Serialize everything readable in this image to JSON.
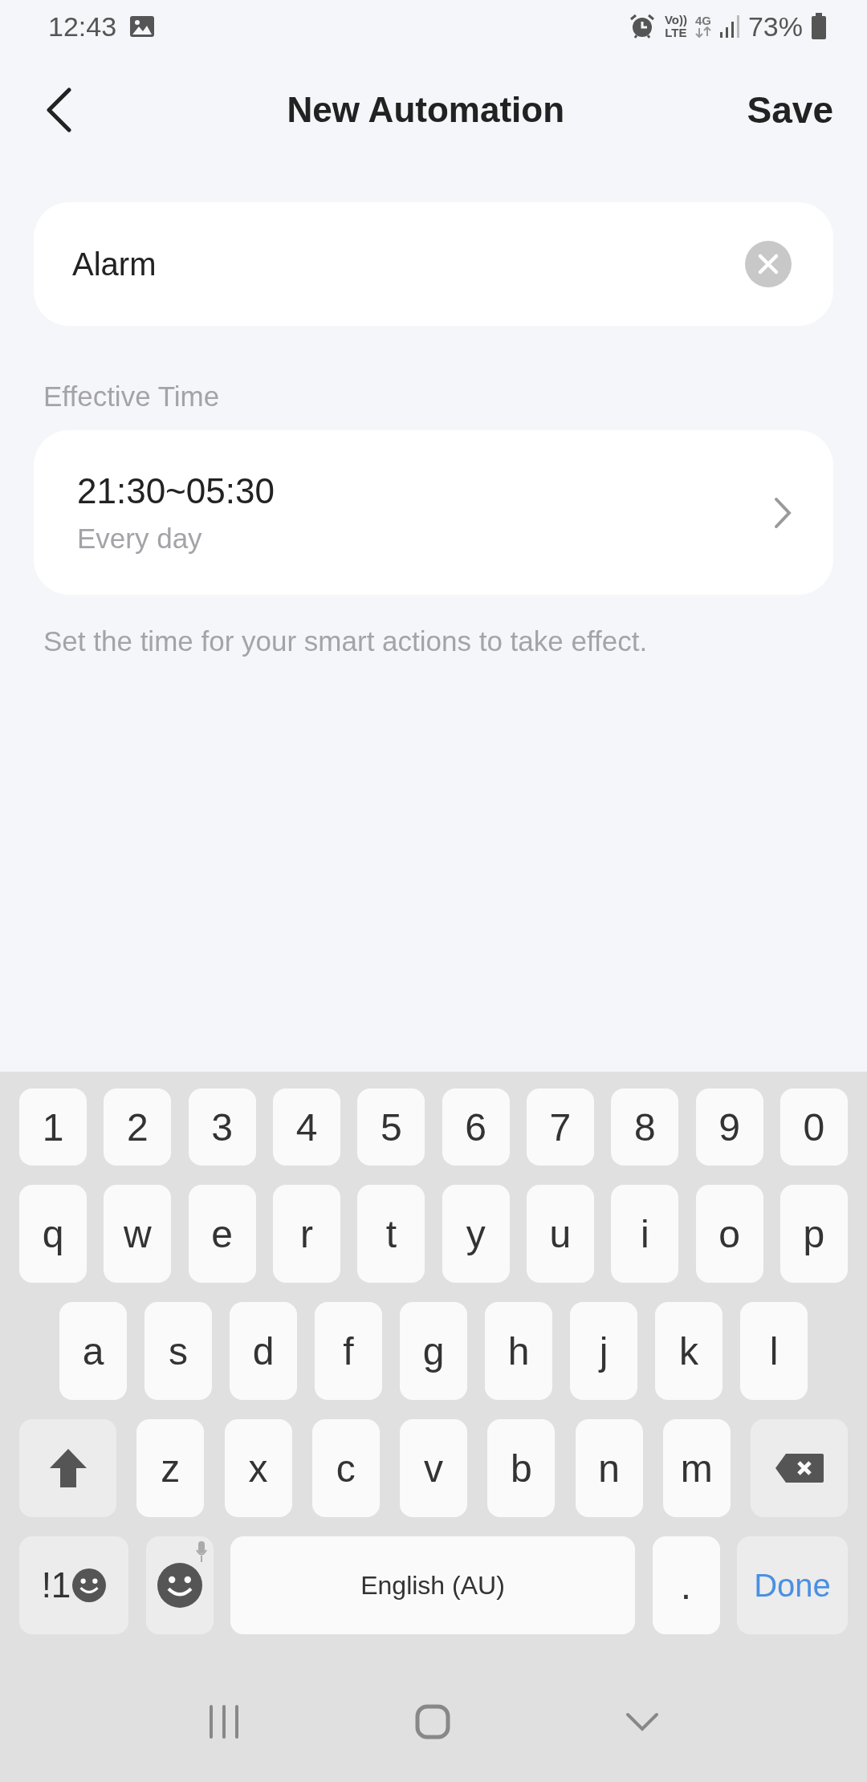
{
  "status_bar": {
    "time": "12:43",
    "volte_top": "Vo))",
    "volte_bottom": "LTE",
    "network": "4G",
    "battery": "73%"
  },
  "header": {
    "title": "New Automation",
    "action": "Save"
  },
  "name_field": {
    "value": "Alarm"
  },
  "effective_time": {
    "label": "Effective Time",
    "time": "21:30~05:30",
    "repeat": "Every day",
    "hint": "Set the time for your smart actions to take effect."
  },
  "keyboard": {
    "number_row": [
      "1",
      "2",
      "3",
      "4",
      "5",
      "6",
      "7",
      "8",
      "9",
      "0"
    ],
    "letter_rows": [
      [
        "q",
        "w",
        "e",
        "r",
        "t",
        "y",
        "u",
        "i",
        "o",
        "p"
      ],
      [
        "a",
        "s",
        "d",
        "f",
        "g",
        "h",
        "j",
        "k",
        "l"
      ],
      [
        "z",
        "x",
        "c",
        "v",
        "b",
        "n",
        "m"
      ]
    ],
    "symbols_key": "!1",
    "space_key": "English (AU)",
    "period_key": ".",
    "done_key": "Done"
  }
}
